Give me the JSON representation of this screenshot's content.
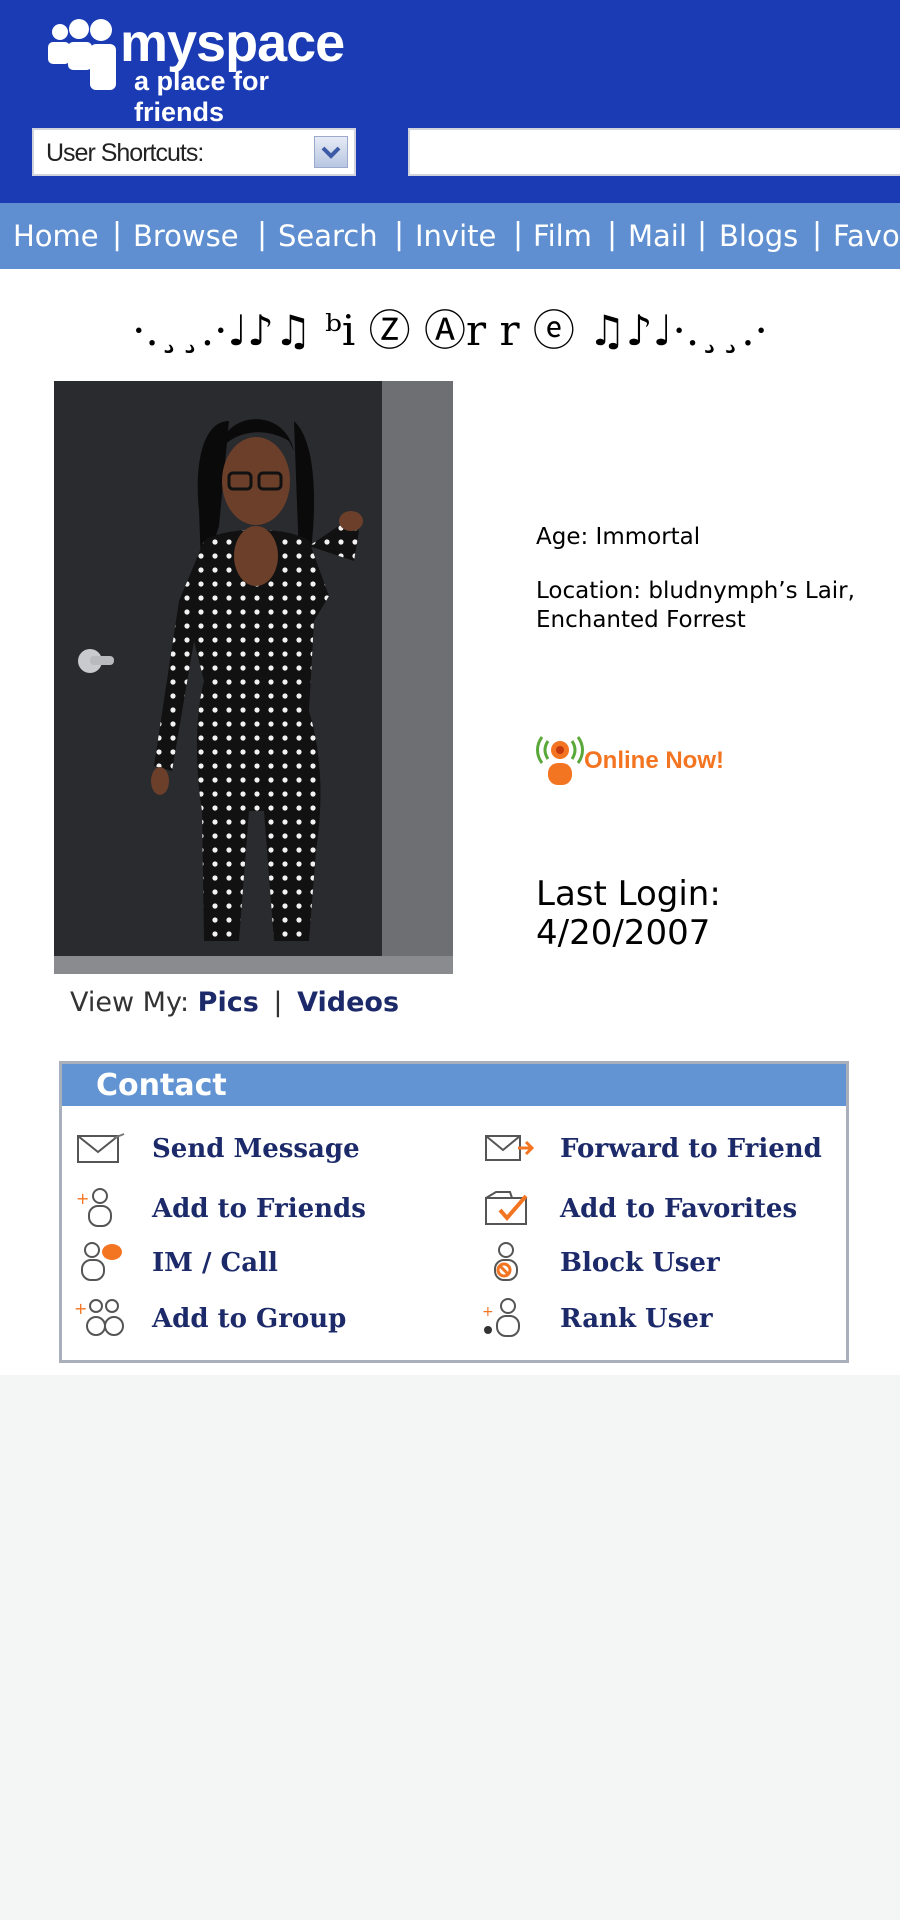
{
  "brand": {
    "name": "myspace",
    "tagline": "a place for friends"
  },
  "header": {
    "shortcuts_label": "User Shortcuts:",
    "search_value": ""
  },
  "nav": {
    "items": [
      "Home",
      "Browse",
      "Search",
      "Invite",
      "Film",
      "Mail",
      "Blogs",
      "Favo"
    ]
  },
  "profile": {
    "display_name": "·.¸¸.·♩♪♫ ᵇi Ⓩ Ⓐr r ⓔ ♫♪♩·.¸¸.·",
    "age": "Age: Immortal",
    "location": "Location: bludnymph’s Lair, Enchanted Forrest",
    "online_status": "Online Now!",
    "last_login_label": "Last Login:",
    "last_login_date": "4/20/2007"
  },
  "view_my": {
    "label": "View My:",
    "pics": "Pics",
    "separator": "|",
    "videos": "Videos"
  },
  "contact": {
    "title": "Contact",
    "actions": {
      "send_message": "Send Message",
      "forward_to_friend": "Forward to Friend",
      "add_to_friends": "Add to Friends",
      "add_to_favorites": "Add to Favorites",
      "im_call": "IM / Call",
      "block_user": "Block User",
      "add_to_group": "Add to Group",
      "rank_user": "Rank User"
    }
  },
  "colors": {
    "header_blue": "#1a3bb3",
    "nav_blue": "#5f8fd1",
    "contact_header": "#6294d3",
    "link_navy": "#1c2a6a",
    "online_orange": "#f47521"
  }
}
